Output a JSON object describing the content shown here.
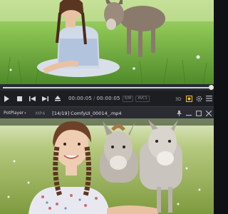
{
  "player": {
    "app_name": "PotPlayer",
    "format": "MP4",
    "file_title": "[14/19] ComfyUI_00014_.mp4",
    "time_current": "00:00:05",
    "time_total": "00:00:05",
    "codec_video": "S/W",
    "codec_audio": "AVC1",
    "progress": 1.0
  },
  "icons": {
    "play": "play-icon",
    "stop": "stop-icon",
    "prev": "previous-icon",
    "next": "next-icon",
    "eject": "eject-icon",
    "threed": "3d-icon",
    "capture": "capture-icon",
    "settings": "gear-icon",
    "playlist": "playlist-icon",
    "pin": "pin-icon",
    "minimize": "minimize-icon",
    "maximize": "maximize-icon",
    "close": "close-icon"
  },
  "colors": {
    "accent": "#f2c230",
    "control_bar": "#1d1e22",
    "title_bar": "#2b2c31"
  }
}
